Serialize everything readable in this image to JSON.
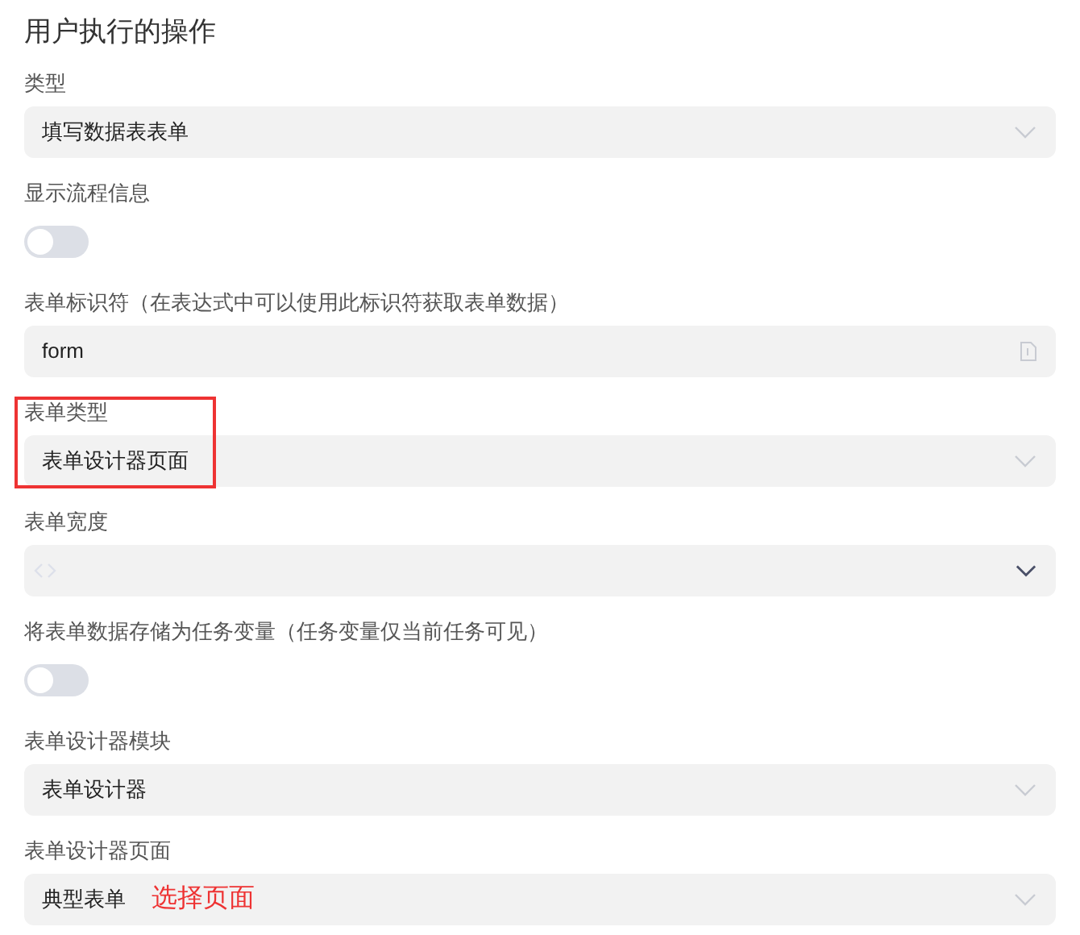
{
  "title": "用户执行的操作",
  "fields": [
    {
      "kind": "select",
      "label": "类型",
      "value": "填写数据表表单",
      "highlighted": false
    },
    {
      "kind": "toggle",
      "label": "显示流程信息",
      "on": false,
      "highlighted": false
    },
    {
      "kind": "input",
      "label": "表单标识符（在表达式中可以使用此标识符获取表单数据）",
      "value": "form",
      "highlighted": false
    },
    {
      "kind": "select",
      "label": "表单类型",
      "value": "表单设计器页面",
      "highlighted": true
    },
    {
      "kind": "code-select",
      "label": "表单宽度",
      "highlighted": false
    },
    {
      "kind": "toggle",
      "label": "将表单数据存储为任务变量（任务变量仅当前任务可见）",
      "on": false,
      "highlighted": false
    },
    {
      "kind": "select",
      "label": "表单设计器模块",
      "value": "表单设计器",
      "highlighted": false
    },
    {
      "kind": "select",
      "label": "表单设计器页面",
      "value": "典型表单",
      "annotation": "选择页面",
      "highlighted": false
    }
  ]
}
